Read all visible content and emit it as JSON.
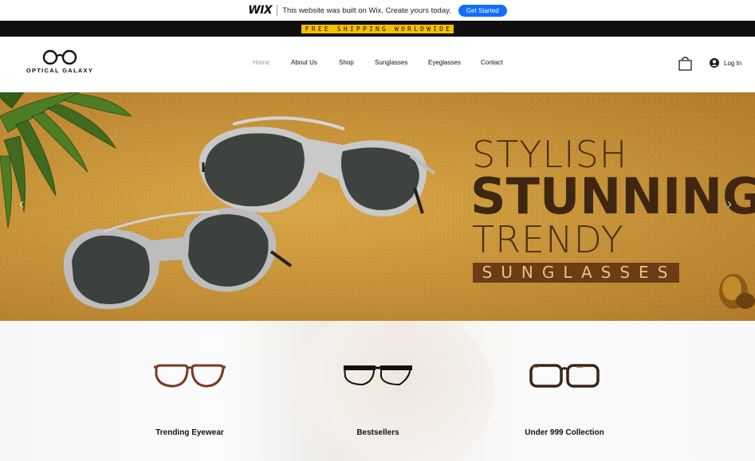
{
  "wix_banner": {
    "logo": "WIX",
    "message": "This website was built on Wix. Create yours today.",
    "cta": "Get Started"
  },
  "shipping": {
    "text": "FREE SHIPPING WORLDWIDE"
  },
  "header": {
    "logo_text": "OPTICAL GALAXY",
    "nav": [
      "Home",
      "About Us",
      "Shop",
      "Sunglasses",
      "Eyeglasses",
      "Contact"
    ],
    "active_nav": "Home",
    "login": "Log In"
  },
  "hero": {
    "line1": "STYLISH",
    "line2": "STUNNING",
    "line3": "TRENDY",
    "line4": "SUNGLASSES",
    "prev_arrow": "‹",
    "next_arrow": "›"
  },
  "collections": [
    {
      "label": "Trending Eyewear",
      "frame_color": "#7a3a22"
    },
    {
      "label": "Bestsellers",
      "frame_color": "#111111"
    },
    {
      "label": "Under 999 Collection",
      "frame_color": "#3a2416"
    }
  ],
  "colors": {
    "wix_blue": "#116dff",
    "shipping_yellow": "#f5c000",
    "hero_text": "#3e2610",
    "sunglasses_band": "#6b3d16"
  }
}
